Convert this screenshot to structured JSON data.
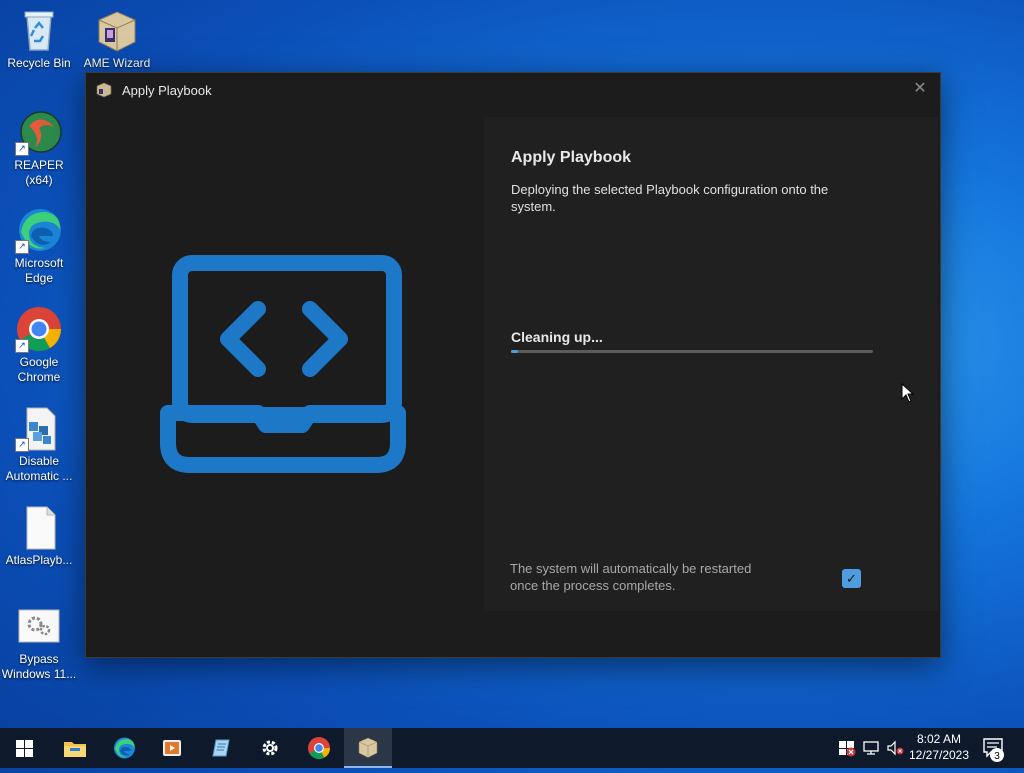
{
  "desktop": {
    "icons": [
      {
        "label": "Recycle Bin",
        "icon": "recycle-bin-icon"
      },
      {
        "label": "AME Wizard",
        "icon": "ame-wizard-icon"
      },
      {
        "label": "REAPER (x64)",
        "icon": "reaper-icon"
      },
      {
        "label": "Microsoft Edge",
        "icon": "edge-icon"
      },
      {
        "label": "Google Chrome",
        "icon": "chrome-icon"
      },
      {
        "label": "Disable Automatic ...",
        "icon": "registry-file-icon"
      },
      {
        "label": "AtlasPlayb...",
        "icon": "blank-file-icon"
      },
      {
        "label": "Bypass Windows 11...",
        "icon": "gear-file-icon"
      }
    ]
  },
  "window": {
    "title": "Apply Playbook",
    "close_glyph": "✕",
    "heading": "Apply Playbook",
    "description": "Deploying the selected Playbook configuration onto the system.",
    "status": "Cleaning up...",
    "progress": 0.02,
    "restart_note": "The system will automatically be restarted once the process completes.",
    "restart_checked": true,
    "check_glyph": "✓",
    "accent": "#4d9de0"
  },
  "taskbar": {
    "apps": [
      "start-icon",
      "file-explorer-icon",
      "edge-icon",
      "media-player-icon",
      "notepad-icon",
      "settings-icon",
      "chrome-icon",
      "ame-wizard-icon"
    ],
    "time": "8:02 AM",
    "date": "12/27/2023",
    "notification_count": "3"
  }
}
